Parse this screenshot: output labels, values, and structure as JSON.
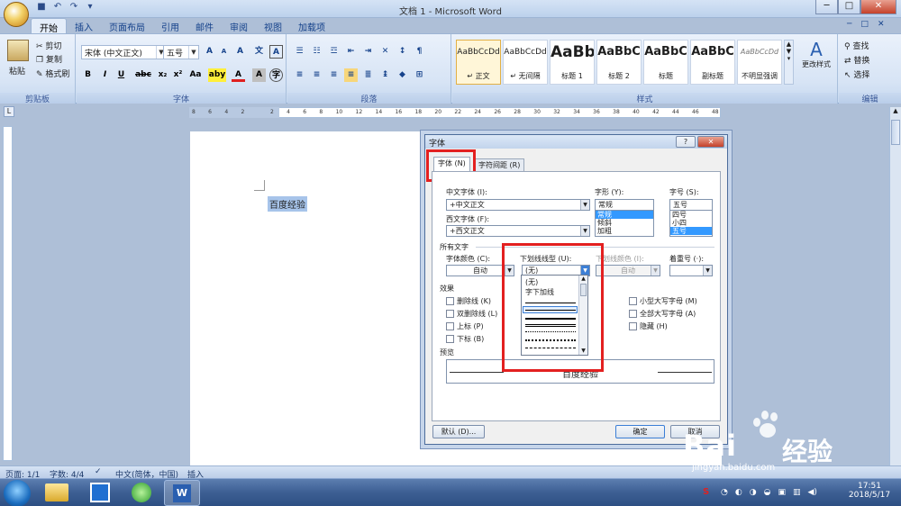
{
  "window": {
    "title": "文档 1 - Microsoft Word",
    "min": "─",
    "max": "□",
    "close": "✕",
    "ribbon_min": "─",
    "ribbon_restore": "□",
    "ribbon_close": "✕"
  },
  "tabs": [
    "开始",
    "插入",
    "页面布局",
    "引用",
    "邮件",
    "审阅",
    "视图",
    "加载项"
  ],
  "clipboard": {
    "paste": "粘贴",
    "cut": "剪切",
    "copy": "复制",
    "format_painter": "格式刷",
    "group": "剪贴板"
  },
  "font_group": {
    "font_name": "宋体 (中文正文)",
    "font_size": "五号",
    "group": "字体",
    "bold": "B",
    "italic": "I",
    "underline": "U",
    "strike": "abc",
    "sub": "x₂",
    "sup": "x²",
    "case": "Aa",
    "grow": "A",
    "shrink": "A",
    "clear": "A",
    "phonetic": "文",
    "border": "A",
    "highlight": "aby",
    "color": "A",
    "shade": "A",
    "circle": "字"
  },
  "paragraph_group": {
    "group": "段落"
  },
  "styles": {
    "group": "样式",
    "items": [
      {
        "sample": "AaBbCcDd",
        "name": "↵ 正文"
      },
      {
        "sample": "AaBbCcDd",
        "name": "↵ 无间隔"
      },
      {
        "sample": "AaBb",
        "name": "标题 1"
      },
      {
        "sample": "AaBbC",
        "name": "标题 2"
      },
      {
        "sample": "AaBbC",
        "name": "标题"
      },
      {
        "sample": "AaBbC",
        "name": "副标题"
      },
      {
        "sample": "AaBbCcDd",
        "name": "不明显强调"
      }
    ],
    "change_styles": "更改样式"
  },
  "editing": {
    "find": "查找",
    "replace": "替换",
    "select": "选择",
    "group": "编辑"
  },
  "ruler": {
    "ticks": [
      "8",
      "6",
      "4",
      "2",
      "",
      "2",
      "4",
      "6",
      "8",
      "10",
      "12",
      "14",
      "16",
      "18",
      "20",
      "22",
      "24",
      "26",
      "28",
      "30",
      "32",
      "34",
      "36",
      "38",
      "40",
      "42",
      "44",
      "46",
      "48"
    ]
  },
  "document": {
    "text": "百度经验"
  },
  "statusbar": {
    "page": "页面: 1/1",
    "words": "字数: 4/4",
    "lang": "中文(简体，中国)",
    "mode": "插入"
  },
  "taskbar": {
    "time": "17:51",
    "date": "2018/5/17",
    "ime": "S"
  },
  "watermark": {
    "brand": "Bai",
    "brand2": "经验",
    "url": "jingyan.baidu.com"
  },
  "dialog": {
    "title": "字体",
    "help": "?",
    "close": "✕",
    "tab_font": "字体 (N)",
    "tab_spacing": "字符间距 (R)",
    "cn_font_label": "中文字体 (I):",
    "cn_font_value": "+中文正文",
    "style_label": "字形 (Y):",
    "style_value": "常规",
    "style_list": [
      "常规",
      "倾斜",
      "加粗"
    ],
    "size_label": "字号 (S):",
    "size_value": "五号",
    "size_list": [
      "四号",
      "小四",
      "五号"
    ],
    "west_font_label": "西文字体 (F):",
    "west_font_value": "+西文正文",
    "all_text": "所有文字",
    "color_label": "字体颜色 (C):",
    "color_value": "自动",
    "underline_label": "下划线线型 (U):",
    "underline_value": "(无)",
    "ul_color_label": "下划线颜色 (I):",
    "ul_color_value": "自动",
    "emphasis_label": "着重号 (·):",
    "emphasis_value": "",
    "effects": "效果",
    "fx_strike": "删除线 (K)",
    "fx_dstrike": "双删除线 (L)",
    "fx_super": "上标 (P)",
    "fx_sub": "下标 (B)",
    "fx_smallcaps": "小型大写字母 (M)",
    "fx_allcaps": "全部大写字母 (A)",
    "fx_hidden": "隐藏 (H)",
    "preview": "预览",
    "preview_text": "百度经验",
    "default_btn": "默认 (D)...",
    "ok_btn": "确定",
    "cancel_btn": "取消",
    "underline_options": [
      "(无)",
      "字下加线"
    ]
  }
}
